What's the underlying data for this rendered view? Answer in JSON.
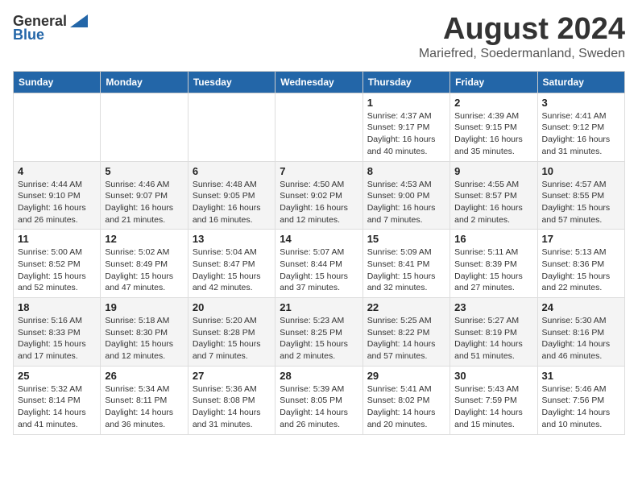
{
  "header": {
    "logo": {
      "general": "General",
      "blue": "Blue"
    },
    "title": "August 2024",
    "subtitle": "Mariefred, Soedermanland, Sweden"
  },
  "days": [
    "Sunday",
    "Monday",
    "Tuesday",
    "Wednesday",
    "Thursday",
    "Friday",
    "Saturday"
  ],
  "weeks": [
    [
      {
        "date": "",
        "info": ""
      },
      {
        "date": "",
        "info": ""
      },
      {
        "date": "",
        "info": ""
      },
      {
        "date": "",
        "info": ""
      },
      {
        "date": "1",
        "info": "Sunrise: 4:37 AM\nSunset: 9:17 PM\nDaylight: 16 hours\nand 40 minutes."
      },
      {
        "date": "2",
        "info": "Sunrise: 4:39 AM\nSunset: 9:15 PM\nDaylight: 16 hours\nand 35 minutes."
      },
      {
        "date": "3",
        "info": "Sunrise: 4:41 AM\nSunset: 9:12 PM\nDaylight: 16 hours\nand 31 minutes."
      }
    ],
    [
      {
        "date": "4",
        "info": "Sunrise: 4:44 AM\nSunset: 9:10 PM\nDaylight: 16 hours\nand 26 minutes."
      },
      {
        "date": "5",
        "info": "Sunrise: 4:46 AM\nSunset: 9:07 PM\nDaylight: 16 hours\nand 21 minutes."
      },
      {
        "date": "6",
        "info": "Sunrise: 4:48 AM\nSunset: 9:05 PM\nDaylight: 16 hours\nand 16 minutes."
      },
      {
        "date": "7",
        "info": "Sunrise: 4:50 AM\nSunset: 9:02 PM\nDaylight: 16 hours\nand 12 minutes."
      },
      {
        "date": "8",
        "info": "Sunrise: 4:53 AM\nSunset: 9:00 PM\nDaylight: 16 hours\nand 7 minutes."
      },
      {
        "date": "9",
        "info": "Sunrise: 4:55 AM\nSunset: 8:57 PM\nDaylight: 16 hours\nand 2 minutes."
      },
      {
        "date": "10",
        "info": "Sunrise: 4:57 AM\nSunset: 8:55 PM\nDaylight: 15 hours\nand 57 minutes."
      }
    ],
    [
      {
        "date": "11",
        "info": "Sunrise: 5:00 AM\nSunset: 8:52 PM\nDaylight: 15 hours\nand 52 minutes."
      },
      {
        "date": "12",
        "info": "Sunrise: 5:02 AM\nSunset: 8:49 PM\nDaylight: 15 hours\nand 47 minutes."
      },
      {
        "date": "13",
        "info": "Sunrise: 5:04 AM\nSunset: 8:47 PM\nDaylight: 15 hours\nand 42 minutes."
      },
      {
        "date": "14",
        "info": "Sunrise: 5:07 AM\nSunset: 8:44 PM\nDaylight: 15 hours\nand 37 minutes."
      },
      {
        "date": "15",
        "info": "Sunrise: 5:09 AM\nSunset: 8:41 PM\nDaylight: 15 hours\nand 32 minutes."
      },
      {
        "date": "16",
        "info": "Sunrise: 5:11 AM\nSunset: 8:39 PM\nDaylight: 15 hours\nand 27 minutes."
      },
      {
        "date": "17",
        "info": "Sunrise: 5:13 AM\nSunset: 8:36 PM\nDaylight: 15 hours\nand 22 minutes."
      }
    ],
    [
      {
        "date": "18",
        "info": "Sunrise: 5:16 AM\nSunset: 8:33 PM\nDaylight: 15 hours\nand 17 minutes."
      },
      {
        "date": "19",
        "info": "Sunrise: 5:18 AM\nSunset: 8:30 PM\nDaylight: 15 hours\nand 12 minutes."
      },
      {
        "date": "20",
        "info": "Sunrise: 5:20 AM\nSunset: 8:28 PM\nDaylight: 15 hours\nand 7 minutes."
      },
      {
        "date": "21",
        "info": "Sunrise: 5:23 AM\nSunset: 8:25 PM\nDaylight: 15 hours\nand 2 minutes."
      },
      {
        "date": "22",
        "info": "Sunrise: 5:25 AM\nSunset: 8:22 PM\nDaylight: 14 hours\nand 57 minutes."
      },
      {
        "date": "23",
        "info": "Sunrise: 5:27 AM\nSunset: 8:19 PM\nDaylight: 14 hours\nand 51 minutes."
      },
      {
        "date": "24",
        "info": "Sunrise: 5:30 AM\nSunset: 8:16 PM\nDaylight: 14 hours\nand 46 minutes."
      }
    ],
    [
      {
        "date": "25",
        "info": "Sunrise: 5:32 AM\nSunset: 8:14 PM\nDaylight: 14 hours\nand 41 minutes."
      },
      {
        "date": "26",
        "info": "Sunrise: 5:34 AM\nSunset: 8:11 PM\nDaylight: 14 hours\nand 36 minutes."
      },
      {
        "date": "27",
        "info": "Sunrise: 5:36 AM\nSunset: 8:08 PM\nDaylight: 14 hours\nand 31 minutes."
      },
      {
        "date": "28",
        "info": "Sunrise: 5:39 AM\nSunset: 8:05 PM\nDaylight: 14 hours\nand 26 minutes."
      },
      {
        "date": "29",
        "info": "Sunrise: 5:41 AM\nSunset: 8:02 PM\nDaylight: 14 hours\nand 20 minutes."
      },
      {
        "date": "30",
        "info": "Sunrise: 5:43 AM\nSunset: 7:59 PM\nDaylight: 14 hours\nand 15 minutes."
      },
      {
        "date": "31",
        "info": "Sunrise: 5:46 AM\nSunset: 7:56 PM\nDaylight: 14 hours\nand 10 minutes."
      }
    ]
  ]
}
